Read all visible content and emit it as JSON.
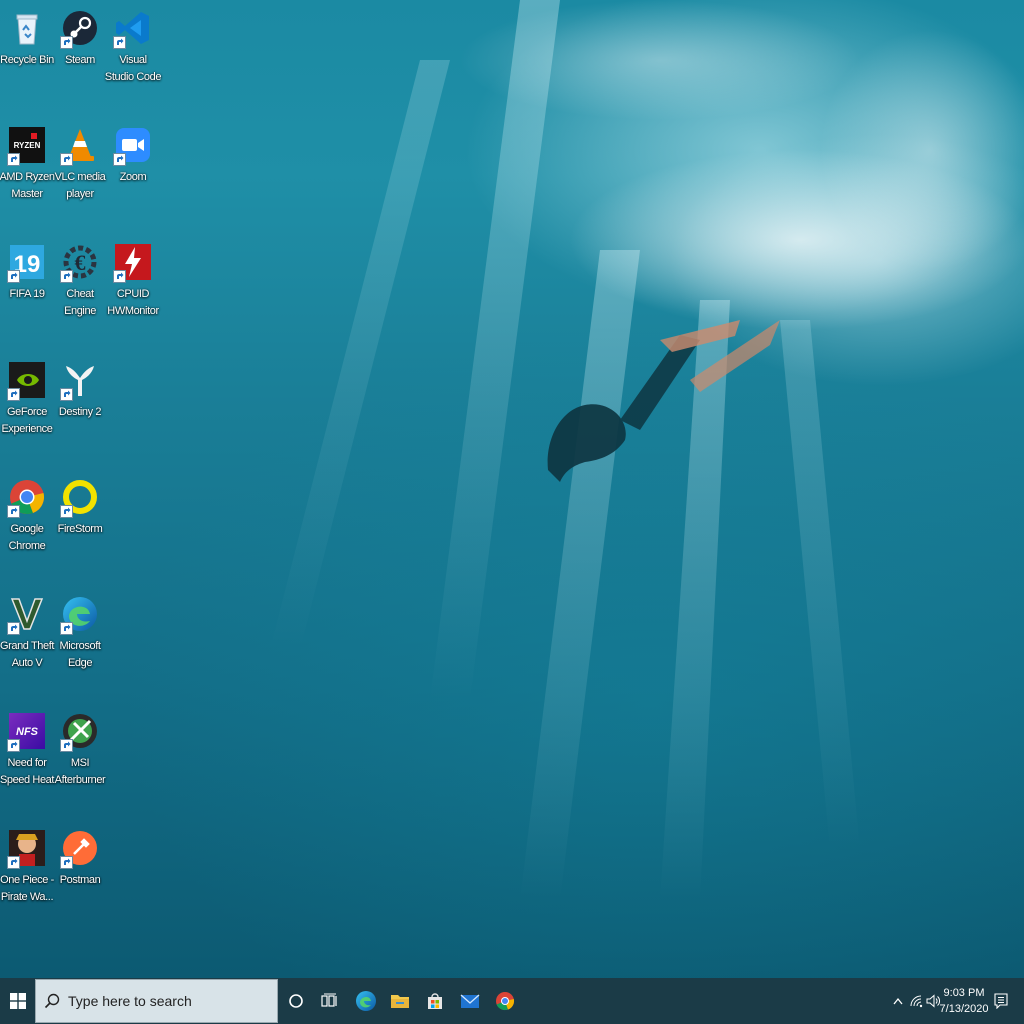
{
  "desktop": {
    "icons": [
      {
        "name": "recycle-bin",
        "label": "Recycle Bin",
        "icon": "recycle-bin-icon"
      },
      {
        "name": "steam",
        "label": "Steam",
        "icon": "steam-icon"
      },
      {
        "name": "visual-studio-code",
        "label": "Visual Studio Code",
        "icon": "vscode-icon"
      },
      {
        "name": "amd-ryzen-master",
        "label": "AMD Ryzen Master",
        "icon": "ryzen-icon",
        "icon_text": "RYZEN"
      },
      {
        "name": "vlc-media-player",
        "label": "VLC media player",
        "icon": "vlc-cone-icon"
      },
      {
        "name": "zoom",
        "label": "Zoom",
        "icon": "zoom-camera-icon"
      },
      {
        "name": "fifa-19",
        "label": "FIFA 19",
        "icon": "fifa-icon",
        "icon_text": "19"
      },
      {
        "name": "cheat-engine",
        "label": "Cheat Engine",
        "icon": "cheat-engine-icon"
      },
      {
        "name": "cpuid-hwmonitor",
        "label": "CPUID HWMonitor",
        "icon": "hwmonitor-bolt-icon"
      },
      {
        "name": "geforce-experience",
        "label": "GeForce Experience",
        "icon": "nvidia-icon"
      },
      {
        "name": "destiny-2",
        "label": "Destiny 2",
        "icon": "destiny-icon"
      },
      {
        "name": "google-chrome",
        "label": "Google Chrome",
        "icon": "chrome-icon"
      },
      {
        "name": "firestorm",
        "label": "FireStorm",
        "icon": "firestorm-ring-icon"
      },
      {
        "name": "grand-theft-auto-v",
        "label": "Grand Theft Auto V",
        "icon": "gta-v-icon",
        "icon_text": "V"
      },
      {
        "name": "microsoft-edge",
        "label": "Microsoft Edge",
        "icon": "edge-icon"
      },
      {
        "name": "need-for-speed-heat",
        "label": "Need for Speed Heat",
        "icon": "nfs-icon",
        "icon_text": "NFS"
      },
      {
        "name": "msi-afterburner",
        "label": "MSI Afterburner",
        "icon": "afterburner-icon"
      },
      {
        "name": "one-piece-pirate-warriors",
        "label": "One Piece - Pirate Wa...",
        "icon": "one-piece-icon"
      },
      {
        "name": "postman",
        "label": "Postman",
        "icon": "postman-icon"
      }
    ]
  },
  "taskbar": {
    "start_icon": "windows-logo-icon",
    "search_placeholder": "Type here to search",
    "pinned": [
      {
        "name": "cortana",
        "icon": "cortana-circle-icon"
      },
      {
        "name": "task-view",
        "icon": "task-view-icon"
      },
      {
        "name": "edge",
        "icon": "edge-icon"
      },
      {
        "name": "file-explorer",
        "icon": "folder-icon"
      },
      {
        "name": "microsoft-store",
        "icon": "store-bag-icon"
      },
      {
        "name": "mail",
        "icon": "mail-icon"
      },
      {
        "name": "chrome",
        "icon": "chrome-icon"
      }
    ],
    "tray": {
      "time": "9:03 PM",
      "date": "7/13/2020"
    }
  },
  "colors": {
    "taskbar": "#1b3b47",
    "search_box": "#d8e3e8",
    "water": "#1a7f98"
  }
}
